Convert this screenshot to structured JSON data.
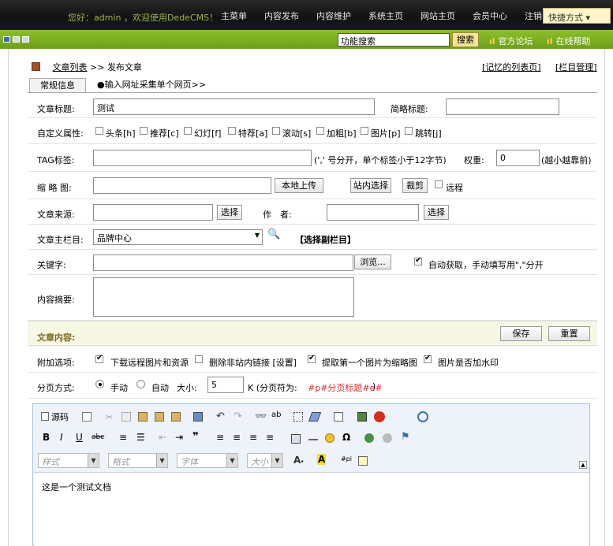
{
  "topbar": {
    "welcome": "您好：admin ，欢迎使用DedeCMS！",
    "nav": [
      "主菜单",
      "内容发布",
      "内容维护",
      "系统主页",
      "网站主页",
      "会员中心",
      "注销"
    ],
    "quick": "快捷方式 ▾"
  },
  "greenbar": {
    "search_value": "功能搜索",
    "search_btn": "搜索",
    "forum": "官方论坛",
    "help": "在线帮助"
  },
  "breadcrumb": {
    "list": "文章列表",
    "sep": ">>",
    "current": "发布文章",
    "recent": "[记忆的列表页]",
    "cat_manage": "[栏目管理]"
  },
  "tabs": {
    "general": "常规信息",
    "collect": "●输入网址采集单个网页>>"
  },
  "form": {
    "title_label": "文章标题:",
    "title_value": "测试",
    "short_title_label": "简略标题:",
    "custom_attr_label": "自定义属性:",
    "attrs": [
      "头条[h]",
      "推荐[c]",
      "幻灯[f]",
      "特荐[a]",
      "滚动[s]",
      "加粗[b]",
      "图片[p]",
      "跳转[j]"
    ],
    "tag_label": "TAG标签:",
    "tag_hint": "(',' 号分开，单个标签小于12字节)",
    "weight_label": "权重:",
    "weight_value": "0",
    "weight_hint": "(越小越靠前)",
    "thumb_label": "缩 略 图:",
    "upload_btn": "本地上传",
    "site_select_btn": "站内选择",
    "crop_btn": "裁剪",
    "remote_label": "远程",
    "source_label": "文章来源:",
    "select_btn": "选择",
    "author_label": "作　者:",
    "author_select_btn": "选择",
    "column_label": "文章主栏目:",
    "column_value": "品牌中心",
    "sub_column_link": "【选择副栏目】",
    "keywords_label": "关键字:",
    "browse_btn": "浏览...",
    "auto_keywords": "自动获取，手动填写用\",\"分开",
    "summary_label": "内容摘要:"
  },
  "content_section": {
    "label": "文章内容:",
    "save_btn": "保存",
    "reset_btn": "重置",
    "extra_label": "附加选项:",
    "extra_opts": [
      "下载远程图片和资源",
      "删除非站内链接 [设置]",
      "提取第一个图片为缩略图",
      "图片是否加水印"
    ],
    "paging_label": "分页方式:",
    "manual": "手动",
    "auto": "自动",
    "size_label": "大小:",
    "size_value": "5",
    "size_unit": "K (分页符为:",
    "paging_marker": "#p#分页标题#e#",
    "paging_close": ")"
  },
  "editor": {
    "source_btn": "源码",
    "style": "样式",
    "format": "格式",
    "font": "字体",
    "size": "大小",
    "body_text": "这是一个测试文档"
  },
  "colors": {
    "green": "#7dad24",
    "red": "#cc3333"
  }
}
